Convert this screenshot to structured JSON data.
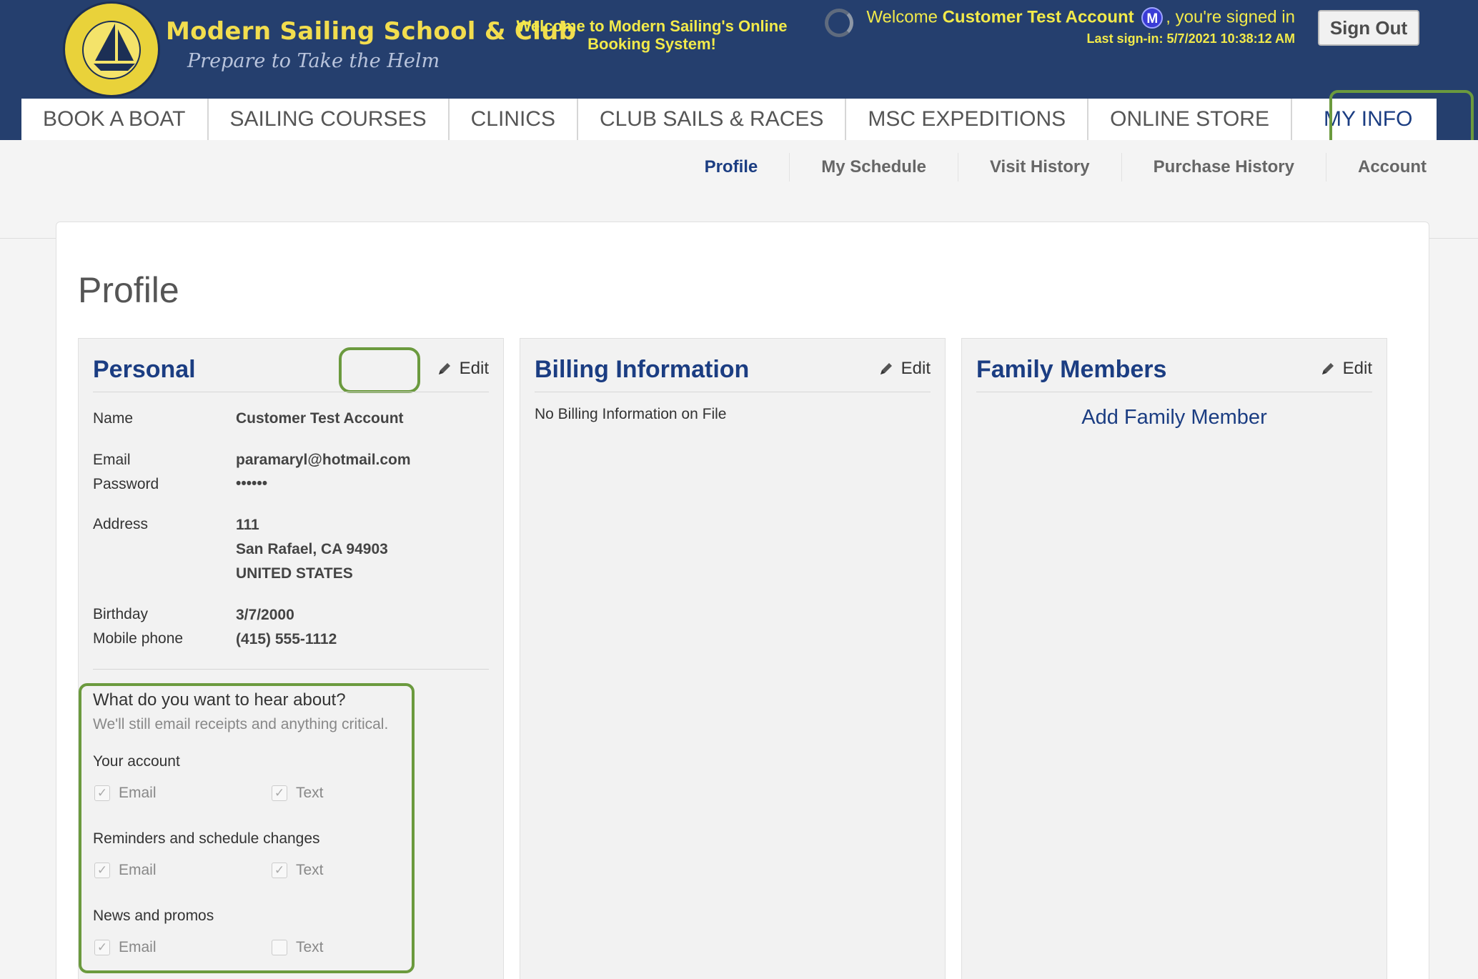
{
  "header": {
    "brand_title": "Modern Sailing School & Club",
    "brand_tagline": "Prepare to Take the Helm",
    "logo_text": "MODERN SAILING SCHOOL & CLUB",
    "welcome_center": "Welcome to Modern Sailing's Online Booking System!",
    "welcome_prefix": "Welcome",
    "user_name": "Customer Test Account",
    "member_badge": "M",
    "signed_in_suffix": ", you're signed in",
    "last_signin": "Last sign-in: 5/7/2021 10:38:12 AM",
    "sign_out": "Sign Out",
    "accent_yellow": "#f2ea4a",
    "header_bg": "#253f6e"
  },
  "main_nav": {
    "tabs": [
      {
        "label": "BOOK A BOAT"
      },
      {
        "label": "SAILING COURSES"
      },
      {
        "label": "CLINICS"
      },
      {
        "label": "CLUB SAILS & RACES"
      },
      {
        "label": "MSC EXPEDITIONS"
      },
      {
        "label": "ONLINE STORE"
      },
      {
        "label": "MY INFO"
      }
    ]
  },
  "sub_nav": {
    "links": [
      {
        "label": "Profile"
      },
      {
        "label": "My Schedule"
      },
      {
        "label": "Visit History"
      },
      {
        "label": "Purchase History"
      },
      {
        "label": "Account"
      }
    ]
  },
  "page": {
    "title": "Profile"
  },
  "personal": {
    "title": "Personal",
    "edit": "Edit",
    "name_label": "Name",
    "name_value": "Customer Test Account",
    "email_label": "Email",
    "email_value": "paramaryl@hotmail.com",
    "password_label": "Password",
    "password_value": "••••••",
    "address_label": "Address",
    "address_line1": "111",
    "address_line2": "San Rafael, CA 94903",
    "address_line3": "UNITED STATES",
    "birthday_label": "Birthday",
    "birthday_value": "3/7/2000",
    "mobile_label": "Mobile phone",
    "mobile_value": "(415) 555-1112"
  },
  "notifications": {
    "title": "What do you want to hear about?",
    "subtitle": "We'll still email receipts and anything critical.",
    "groups": [
      {
        "label": "Your account",
        "email": "Email",
        "text": "Text",
        "email_checked": "✓",
        "text_checked": "✓"
      },
      {
        "label": "Reminders and schedule changes",
        "email": "Email",
        "text": "Text",
        "email_checked": "✓",
        "text_checked": "✓"
      },
      {
        "label": "News and promos",
        "email": "Email",
        "text": "Text",
        "email_checked": "✓",
        "text_checked": ""
      }
    ]
  },
  "billing": {
    "title": "Billing Information",
    "edit": "Edit",
    "empty": "No Billing Information on File"
  },
  "family": {
    "title": "Family Members",
    "edit": "Edit",
    "add": "Add Family Member"
  }
}
